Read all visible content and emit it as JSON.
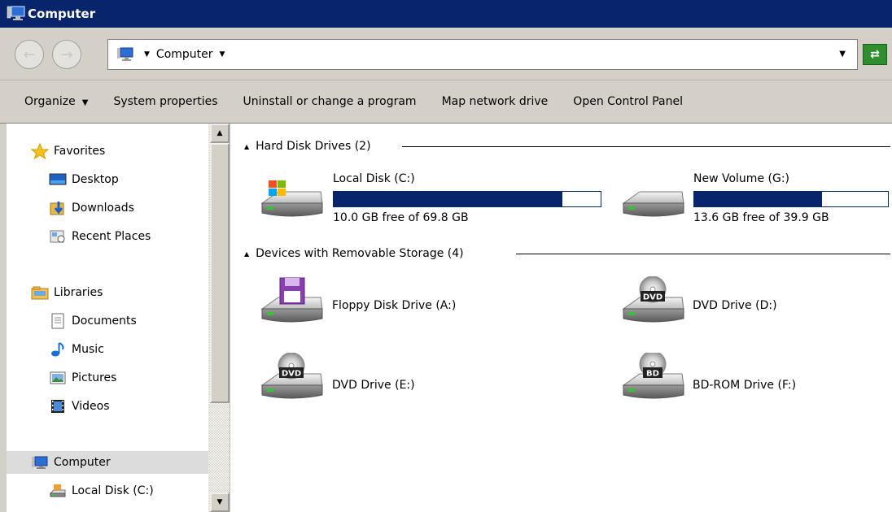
{
  "window": {
    "title": "Computer"
  },
  "address": {
    "breadcrumb": "Computer"
  },
  "commands": [
    {
      "label": "Organize"
    },
    {
      "label": "System properties"
    },
    {
      "label": "Uninstall or change a program"
    },
    {
      "label": "Map network drive"
    },
    {
      "label": "Open Control Panel"
    }
  ],
  "nav": {
    "favorites_label": "Favorites",
    "favorites": [
      {
        "label": "Desktop",
        "icon": "desktop-icon"
      },
      {
        "label": "Downloads",
        "icon": "downloads-icon"
      },
      {
        "label": "Recent Places",
        "icon": "recent-places-icon"
      }
    ],
    "libraries_label": "Libraries",
    "libraries": [
      {
        "label": "Documents",
        "icon": "documents-icon"
      },
      {
        "label": "Music",
        "icon": "music-icon"
      },
      {
        "label": "Pictures",
        "icon": "pictures-icon"
      },
      {
        "label": "Videos",
        "icon": "videos-icon"
      }
    ],
    "computer_label": "Computer",
    "computer_children": [
      {
        "label": "Local Disk (C:)",
        "icon": "local-disk-icon"
      }
    ]
  },
  "groups": {
    "hard_disks": {
      "label": "Hard Disk Drives (2)",
      "drives": [
        {
          "name": "Local Disk (C:)",
          "free_text": "10.0 GB free of 69.8 GB",
          "used_fraction": 0.857
        },
        {
          "name": "New Volume (G:)",
          "free_text": "13.6 GB free of 39.9 GB",
          "used_fraction": 0.659
        }
      ]
    },
    "removable": {
      "label": "Devices with Removable Storage (4)",
      "drives": [
        {
          "name": "Floppy Disk Drive (A:)",
          "badge": ""
        },
        {
          "name": "DVD Drive (D:)",
          "badge": "DVD"
        },
        {
          "name": "DVD Drive (E:)",
          "badge": "DVD"
        },
        {
          "name": "BD-ROM Drive (F:)",
          "badge": "BD"
        }
      ]
    }
  },
  "colors": {
    "titlebar": "#08246b",
    "chrome": "#d4d0c8",
    "usage_bar": "#08246b",
    "selection": "#dcdcdc"
  }
}
